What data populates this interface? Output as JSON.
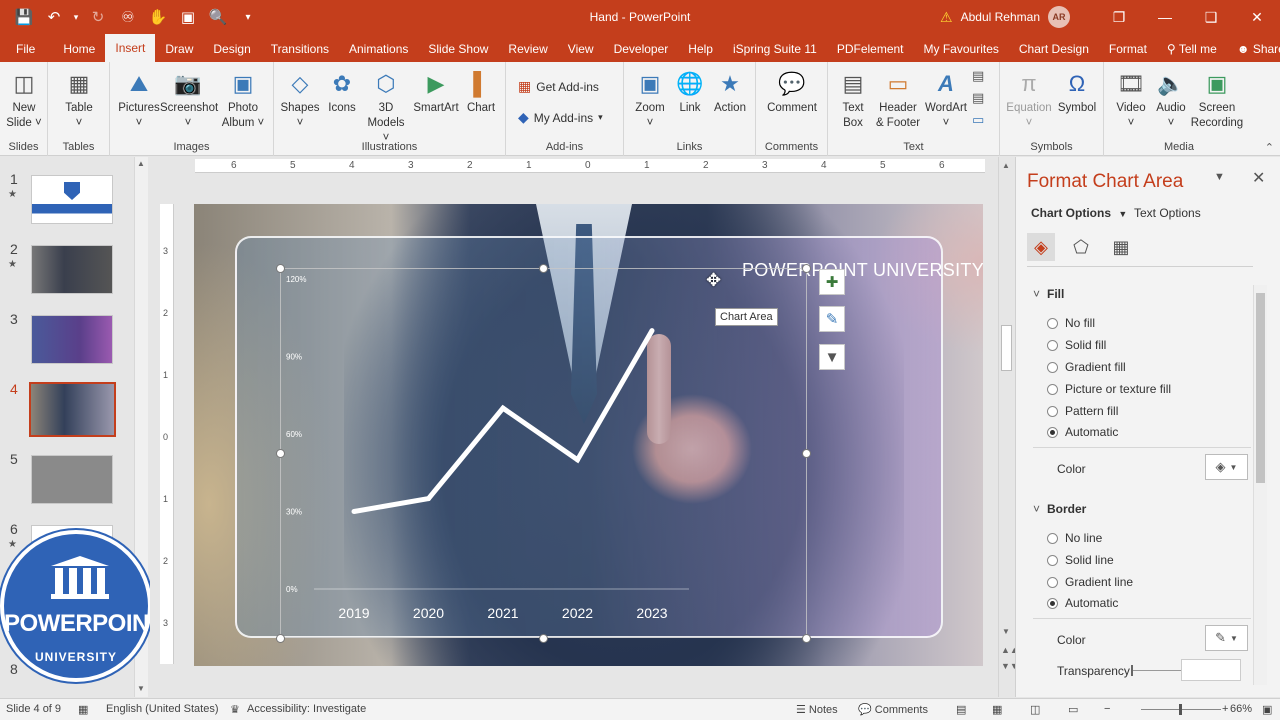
{
  "window": {
    "title": "Hand  -  PowerPoint",
    "user_name": "Abdul Rehman",
    "user_initials": "AR"
  },
  "tabs": [
    "File",
    "Home",
    "Insert",
    "Draw",
    "Design",
    "Transitions",
    "Animations",
    "Slide Show",
    "Review",
    "View",
    "Developer",
    "Help",
    "iSpring Suite 11",
    "PDFelement",
    "My Favourites",
    "Chart Design",
    "Format",
    "Tell me",
    "Share"
  ],
  "active_tab": "Insert",
  "ribbon": {
    "groups": {
      "slides": "Slides",
      "tables": "Tables",
      "images": "Images",
      "illustrations": "Illustrations",
      "addins": "Add-ins",
      "links": "Links",
      "comments": "Comments",
      "text": "Text",
      "symbols": "Symbols",
      "media": "Media"
    },
    "buttons": {
      "new_slide_1": "New",
      "new_slide_2": "Slide ˅",
      "table_1": "Table",
      "table_2": "˅",
      "pictures_1": "Pictures",
      "pictures_2": "˅",
      "screenshot_1": "Screenshot",
      "screenshot_2": "˅",
      "photo_album_1": "Photo",
      "photo_album_2": "Album ˅",
      "shapes_1": "Shapes",
      "shapes_2": "˅",
      "icons": "Icons",
      "models_1": "3D",
      "models_2": "Models ˅",
      "smartart": "SmartArt",
      "chart": "Chart",
      "get_addins": "Get Add-ins",
      "my_addins": "My Add-ins",
      "zoom_1": "Zoom",
      "zoom_2": "˅",
      "link": "Link",
      "action": "Action",
      "comment": "Comment",
      "textbox_1": "Text",
      "textbox_2": "Box",
      "header_1": "Header",
      "header_2": "& Footer",
      "wordart_1": "WordArt",
      "wordart_2": "˅",
      "equation_1": "Equation",
      "equation_2": "˅",
      "symbol": "Symbol",
      "video_1": "Video",
      "video_2": "˅",
      "audio_1": "Audio",
      "audio_2": "˅",
      "screen_rec_1": "Screen",
      "screen_rec_2": "Recording"
    }
  },
  "thumbnails": {
    "numbers": [
      "1",
      "2",
      "3",
      "4",
      "5",
      "6",
      "8"
    ],
    "active": "4"
  },
  "ruler": {
    "h_ticks": [
      "6",
      "5",
      "4",
      "3",
      "2",
      "1",
      "0",
      "1",
      "2",
      "3",
      "4",
      "5",
      "6"
    ],
    "v_ticks": [
      "3",
      "2",
      "1",
      "0",
      "1",
      "2",
      "3"
    ]
  },
  "slide": {
    "panel_title": "POWERPOINT UNIVERSITY",
    "tooltip": "Chart Area"
  },
  "chart_data": {
    "type": "line",
    "categories": [
      "2019",
      "2020",
      "2021",
      "2022",
      "2023"
    ],
    "values": [
      30,
      35,
      70,
      50,
      100
    ],
    "y_ticks": [
      "0%",
      "30%",
      "60%",
      "90%",
      "120%"
    ],
    "ylim": [
      0,
      120
    ],
    "series_color": "#ffffff",
    "grid": false
  },
  "badge": {
    "line1": "POWERPOINT",
    "line2": "UNIVERSITY"
  },
  "format_pane": {
    "title": "Format Chart Area",
    "tab_chart_options": "Chart Options",
    "tab_text_options": "Text Options",
    "fill_section": "Fill",
    "fill_options": [
      "No fill",
      "Solid fill",
      "Gradient fill",
      "Picture or texture fill",
      "Pattern fill",
      "Automatic"
    ],
    "fill_selected": "Automatic",
    "color_label": "Color",
    "border_section": "Border",
    "border_options": [
      "No line",
      "Solid line",
      "Gradient line",
      "Automatic"
    ],
    "border_selected": "Automatic",
    "border_color_label": "Color",
    "transparency_label": "Transparency"
  },
  "statusbar": {
    "slide_info": "Slide 4 of 9",
    "language": "English (United States)",
    "accessibility": "Accessibility: Investigate",
    "notes": "Notes",
    "comments": "Comments",
    "zoom": "66%"
  },
  "colors": {
    "accent": "#c43e1c",
    "ribbon_bg": "#f3f3f3"
  }
}
